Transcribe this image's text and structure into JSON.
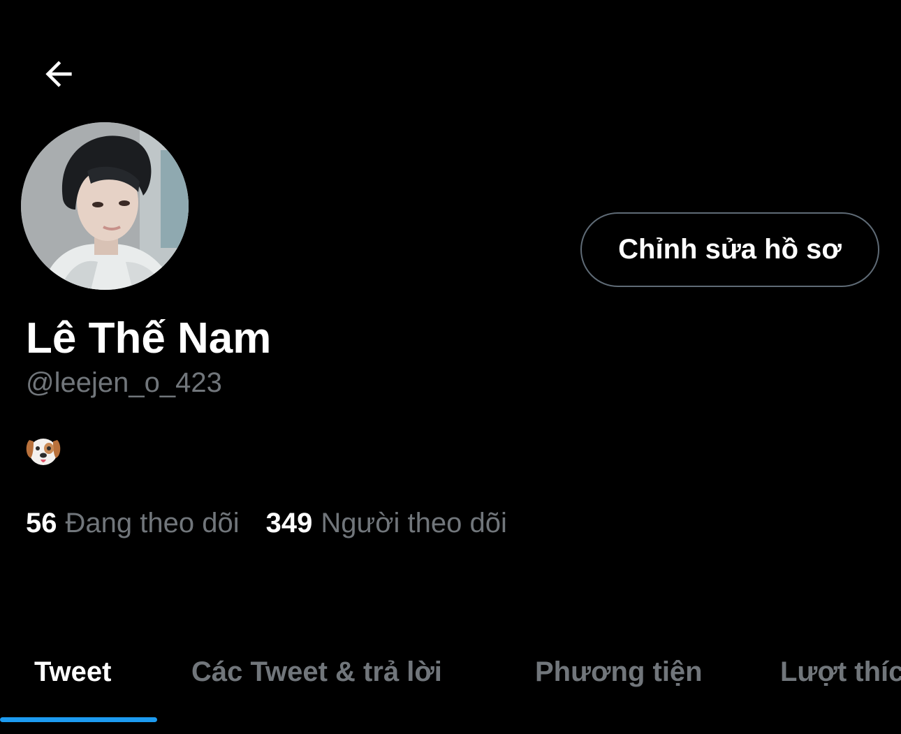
{
  "header": {
    "back_icon": "arrow-left-icon"
  },
  "profile": {
    "avatar_icon": "profile-photo",
    "display_name": "Lê Thế Nam",
    "handle": "@leejen_o_423",
    "bio_emoji": "dog-face-emoji",
    "edit_button_label": "Chỉnh sửa hồ sơ",
    "following_count": "56",
    "following_label": "Đang theo dõi",
    "followers_count": "349",
    "followers_label": "Người theo dõi"
  },
  "tabs": [
    {
      "label": "Tweet",
      "active": true
    },
    {
      "label": "Các Tweet & trả lời",
      "active": false
    },
    {
      "label": "Phương tiện",
      "active": false
    },
    {
      "label": "Lượt thích",
      "active": false
    }
  ],
  "colors": {
    "background": "#000000",
    "primary_text": "#ffffff",
    "secondary_text": "#71767b",
    "button_border": "#5f6b76",
    "accent": "#1d9bf0"
  }
}
